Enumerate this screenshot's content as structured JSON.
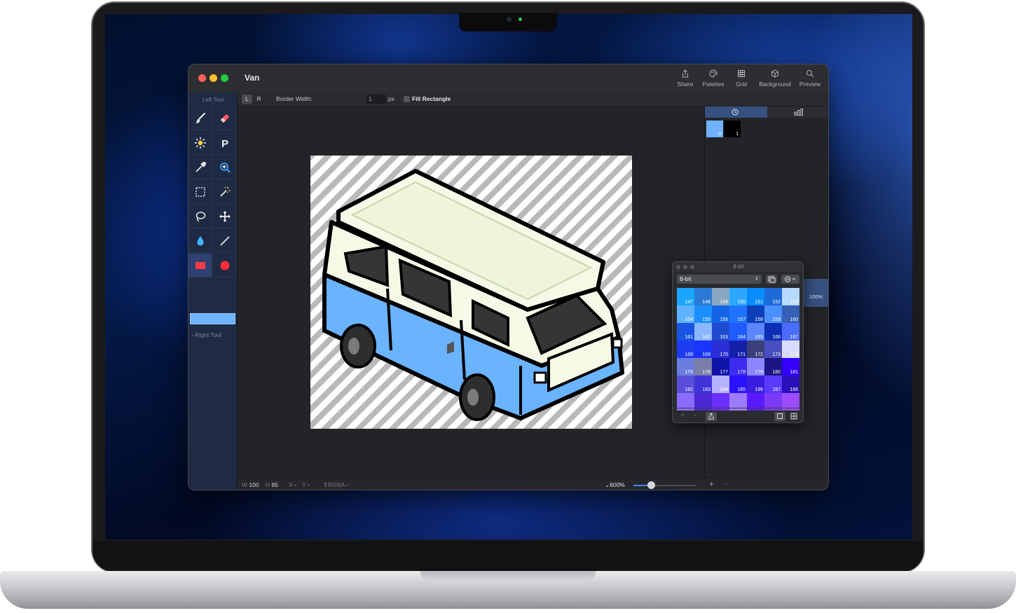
{
  "window": {
    "title": "Van",
    "toolbar": {
      "share": "Share",
      "palettes": "Palettes",
      "grid": "Grid",
      "background": "Background",
      "preview": "Preview"
    }
  },
  "options_bar": {
    "left_seg": "L",
    "right_seg": "R",
    "border_width_label": "Border Width:",
    "border_width_value": "1",
    "unit": "px",
    "fill_rectangle_label": "Fill Rectangle"
  },
  "sidebar": {
    "left_tool_label": "Left Tool",
    "right_tool_label": "Right Tool",
    "primary_color": "#6fb2ff"
  },
  "layers": [
    {
      "index": "0",
      "color": "#6fb2ff"
    },
    {
      "index": "1",
      "color": "#000000"
    }
  ],
  "palette_panel": {
    "title": "8-bit",
    "selected_palette": "8-bit",
    "swatches": [
      {
        "n": "147",
        "c": "#1aa6ff"
      },
      {
        "n": "148",
        "c": "#2b7bd6"
      },
      {
        "n": "149",
        "c": "#8aa7c0"
      },
      {
        "n": "150",
        "c": "#2ea8ff"
      },
      {
        "n": "151",
        "c": "#0a8cff"
      },
      {
        "n": "152",
        "c": "#1d6ad8"
      },
      {
        "n": "153",
        "c": "#b7d8ff"
      },
      {
        "n": "154",
        "c": "#5fb2ff"
      },
      {
        "n": "155",
        "c": "#1d8eff"
      },
      {
        "n": "156",
        "c": "#1464e6"
      },
      {
        "n": "157",
        "c": "#1f73ff"
      },
      {
        "n": "158",
        "c": "#0e3fb8"
      },
      {
        "n": "159",
        "c": "#4b8fff"
      },
      {
        "n": "160",
        "c": "#3560b6"
      },
      {
        "n": "161",
        "c": "#1b54e4"
      },
      {
        "n": "162",
        "c": "#8ab6ff"
      },
      {
        "n": "163",
        "c": "#1e4bcf"
      },
      {
        "n": "164",
        "c": "#1f5cff"
      },
      {
        "n": "165",
        "c": "#5b86ff"
      },
      {
        "n": "166",
        "c": "#0d2fb5"
      },
      {
        "n": "167",
        "c": "#4a6dff"
      },
      {
        "n": "168",
        "c": "#1c3df2"
      },
      {
        "n": "169",
        "c": "#1b34ff"
      },
      {
        "n": "170",
        "c": "#2a2fd6"
      },
      {
        "n": "171",
        "c": "#1520a8"
      },
      {
        "n": "172",
        "c": "#3b3f78"
      },
      {
        "n": "173",
        "c": "#4a4fbf"
      },
      {
        "n": "174",
        "c": "#d7dcff"
      },
      {
        "n": "175",
        "c": "#6b7ee0"
      },
      {
        "n": "176",
        "c": "#7a7fa9"
      },
      {
        "n": "177",
        "c": "#0f13a8"
      },
      {
        "n": "178",
        "c": "#3c2cf2"
      },
      {
        "n": "179",
        "c": "#8a87ff"
      },
      {
        "n": "180",
        "c": "#1b1684"
      },
      {
        "n": "181",
        "c": "#3300ff"
      },
      {
        "n": "182",
        "c": "#5a4fd8"
      },
      {
        "n": "183",
        "c": "#3e34d8"
      },
      {
        "n": "184",
        "c": "#b7b2ff"
      },
      {
        "n": "185",
        "c": "#2a12ff"
      },
      {
        "n": "186",
        "c": "#3a1ee0"
      },
      {
        "n": "187",
        "c": "#5b3aff"
      },
      {
        "n": "188",
        "c": "#2c0fb8"
      },
      {
        "n": "",
        "c": "#8a6cff"
      },
      {
        "n": "",
        "c": "#4a28d6"
      },
      {
        "n": "",
        "c": "#6a30ff"
      },
      {
        "n": "",
        "c": "#9d7bff"
      },
      {
        "n": "",
        "c": "#5a1aff"
      },
      {
        "n": "",
        "c": "#7b3af5"
      },
      {
        "n": "",
        "c": "#9b4dff"
      }
    ]
  },
  "zoom_tab": "100%",
  "status": {
    "w_label": "W",
    "w_value": "100",
    "h_label": "H",
    "h_value": "85",
    "x_label": "X",
    "x_value": "-",
    "y_label": "Y",
    "y_value": "-",
    "mode": "RGBA",
    "mode_value": "-",
    "zoom": "600%",
    "zoom_slider_fraction": 0.28
  }
}
